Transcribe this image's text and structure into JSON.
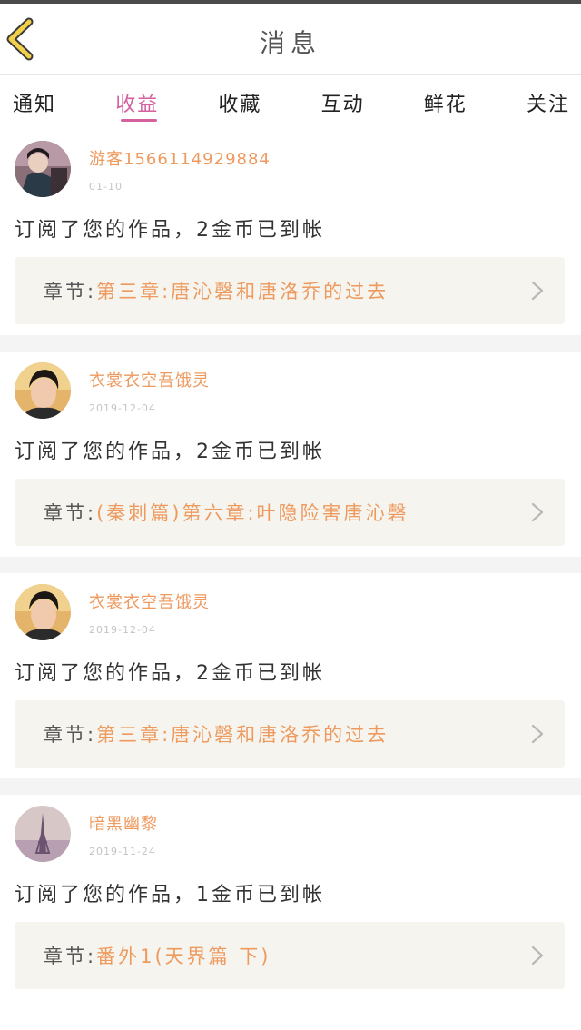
{
  "header": {
    "title": "消息",
    "back_icon": "chevron-left-icon",
    "back_color": "#f2d04a"
  },
  "tabs": [
    {
      "label": "通知",
      "active": false
    },
    {
      "label": "收益",
      "active": true
    },
    {
      "label": "收藏",
      "active": false
    },
    {
      "label": "互动",
      "active": false
    },
    {
      "label": "鲜花",
      "active": false
    },
    {
      "label": "关注",
      "active": false
    }
  ],
  "accent_color": "#d4609d",
  "name_color": "#ee9a5f",
  "messages": [
    {
      "user": "游客1566114929884",
      "date": "01-10",
      "text": "订阅了您的作品，2金币已到帐",
      "chapter_prefix": "章节:",
      "chapter_title": "第三章:唐沁磬和唐洛乔的过去"
    },
    {
      "user": "衣裳衣空吾饿灵",
      "date": "2019-12-04",
      "text": "订阅了您的作品，2金币已到帐",
      "chapter_prefix": "章节:",
      "chapter_title": "(秦刺篇)第六章:叶隐险害唐沁磬"
    },
    {
      "user": "衣裳衣空吾饿灵",
      "date": "2019-12-04",
      "text": "订阅了您的作品，2金币已到帐",
      "chapter_prefix": "章节:",
      "chapter_title": "第三章:唐沁磬和唐洛乔的过去"
    },
    {
      "user": "暗黑幽黎",
      "date": "2019-11-24",
      "text": "订阅了您的作品，1金币已到帐",
      "chapter_prefix": "章节:",
      "chapter_title": "番外1(天界篇 下)"
    }
  ]
}
